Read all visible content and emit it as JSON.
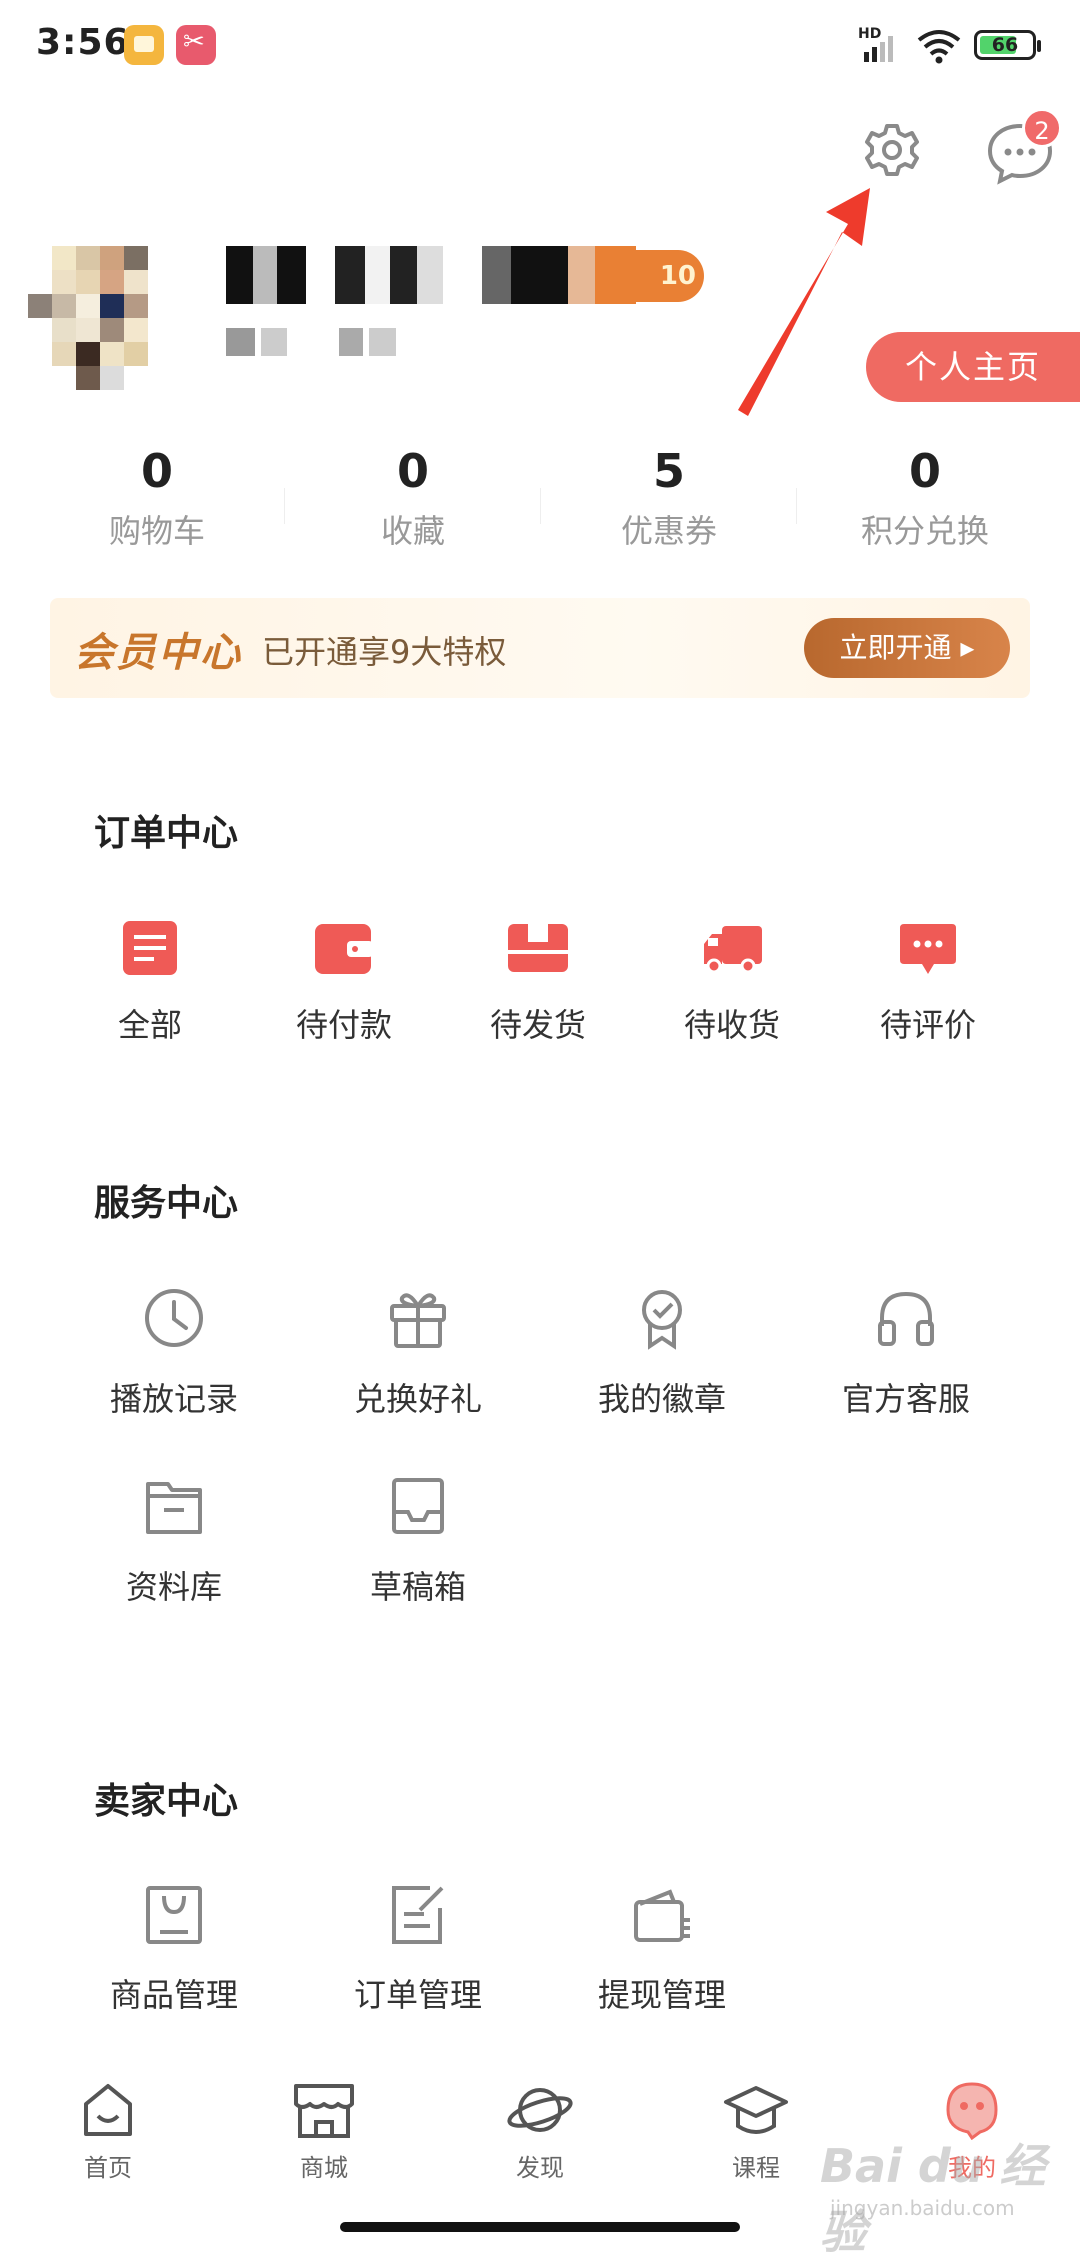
{
  "status_bar": {
    "time": "3:56",
    "network": "HD",
    "battery": "66"
  },
  "header": {
    "message_badge": "2",
    "homepage_button": "个人主页",
    "level": "10"
  },
  "stats": [
    {
      "value": "0",
      "label": "购物车"
    },
    {
      "value": "0",
      "label": "收藏"
    },
    {
      "value": "5",
      "label": "优惠券"
    },
    {
      "value": "0",
      "label": "积分兑换"
    }
  ],
  "member": {
    "title": "会员中心",
    "desc": "已开通享9大特权",
    "button": "立即开通 ▸"
  },
  "orders": {
    "title": "订单中心",
    "items": [
      {
        "label": "全部",
        "icon": "list-icon"
      },
      {
        "label": "待付款",
        "icon": "wallet-icon"
      },
      {
        "label": "待发货",
        "icon": "box-icon"
      },
      {
        "label": "待收货",
        "icon": "truck-icon"
      },
      {
        "label": "待评价",
        "icon": "comment-icon"
      }
    ]
  },
  "services": {
    "title": "服务中心",
    "items": [
      {
        "label": "播放记录",
        "icon": "clock-icon"
      },
      {
        "label": "兑换好礼",
        "icon": "gift-icon"
      },
      {
        "label": "我的徽章",
        "icon": "badge-icon"
      },
      {
        "label": "官方客服",
        "icon": "headphones-icon"
      },
      {
        "label": "资料库",
        "icon": "folder-icon"
      },
      {
        "label": "草稿箱",
        "icon": "inbox-icon"
      }
    ]
  },
  "seller": {
    "title": "卖家中心",
    "items": [
      {
        "label": "商品管理",
        "icon": "bag-icon"
      },
      {
        "label": "订单管理",
        "icon": "edit-doc-icon"
      },
      {
        "label": "提现管理",
        "icon": "wallet-outline-icon"
      }
    ]
  },
  "nav": [
    {
      "label": "首页",
      "icon": "home-icon"
    },
    {
      "label": "商城",
      "icon": "shop-icon"
    },
    {
      "label": "发现",
      "icon": "planet-icon"
    },
    {
      "label": "课程",
      "icon": "graduation-cap-icon"
    },
    {
      "label": "我的",
      "icon": "mascot-icon"
    }
  ],
  "watermark": {
    "main": "Bai du 经验",
    "sub": "jingyan.baidu.com"
  },
  "colors": {
    "accent": "#ef6a62",
    "member_gold": "#c8762c",
    "order_icon": "#ef5a56"
  }
}
